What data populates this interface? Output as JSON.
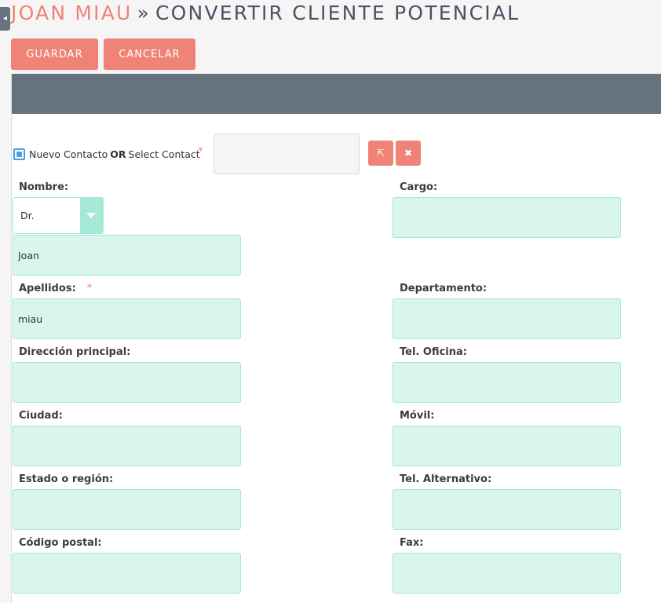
{
  "header": {
    "side_tab_icon": "collapse-icon",
    "breadcrumb": "Joan Miau",
    "separator": "»",
    "title": "Convertir Cliente Potencial"
  },
  "actions": {
    "save_label": "GUARDAR",
    "cancel_label": "CANCELAR"
  },
  "contact": {
    "new_contact_label": "Nuevo Contacto",
    "or_label": "OR",
    "select_contact_label": "Select Contact",
    "required_mark": "*",
    "new_contact_checked": true,
    "select_icon": "arrow-select-icon",
    "clear_icon": "clear-x-icon",
    "select_glyph": "⇱",
    "clear_glyph": "✖"
  },
  "form": {
    "required_mark": "*",
    "nombre_label": "Nombre:",
    "salutation_value": "Dr.",
    "first_name_value": "Joan",
    "cargo_label": "Cargo:",
    "cargo_value": "",
    "apellidos_label": "Apellidos:",
    "last_name_value": "miau",
    "departamento_label": "Departamento:",
    "departamento_value": "",
    "direccion_label": "Dirección principal:",
    "direccion_value": "",
    "tel_oficina_label": "Tel. Oficina:",
    "tel_oficina_value": "",
    "ciudad_label": "Ciudad:",
    "ciudad_value": "",
    "movil_label": "Móvil:",
    "movil_value": "",
    "estado_label": "Estado o región:",
    "estado_value": "",
    "tel_alternativo_label": "Tel. Alternativo:",
    "tel_alternativo_value": "",
    "codigo_postal_label": "Código postal:",
    "codigo_postal_value": "",
    "fax_label": "Fax:",
    "fax_value": ""
  },
  "colors": {
    "accent": "#f08377",
    "title": "#534d64",
    "panel_header": "#66727d",
    "field_bg": "#d8f5ee",
    "field_border": "#a5e8d6",
    "checkbox": "#4a9fe0"
  }
}
